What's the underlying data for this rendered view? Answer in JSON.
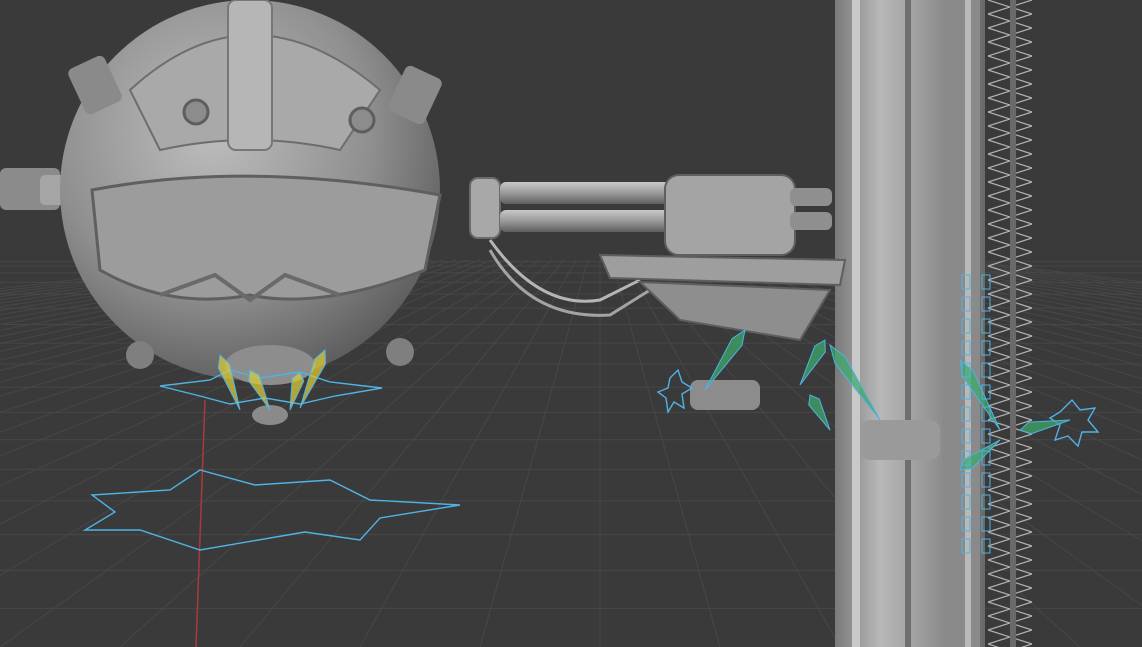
{
  "viewport": {
    "background": "#3a3a3a",
    "grid_color": "#4a4a4a",
    "axis_x_color": "#a83a3a",
    "model_color": "#9a9a9a",
    "rig_color": "#4fb3e6",
    "bone_color": "#3fa86a",
    "selected_bone_color": "#d9c93a"
  },
  "objects": [
    {
      "name": "sphere-drone-body",
      "icon": "sphere-mesh-icon"
    },
    {
      "name": "gatling-turret",
      "icon": "cannon-mesh-icon"
    },
    {
      "name": "lattice-pillar",
      "icon": "pillar-mesh-icon"
    },
    {
      "name": "armature-controls",
      "icon": "armature-icon"
    }
  ]
}
